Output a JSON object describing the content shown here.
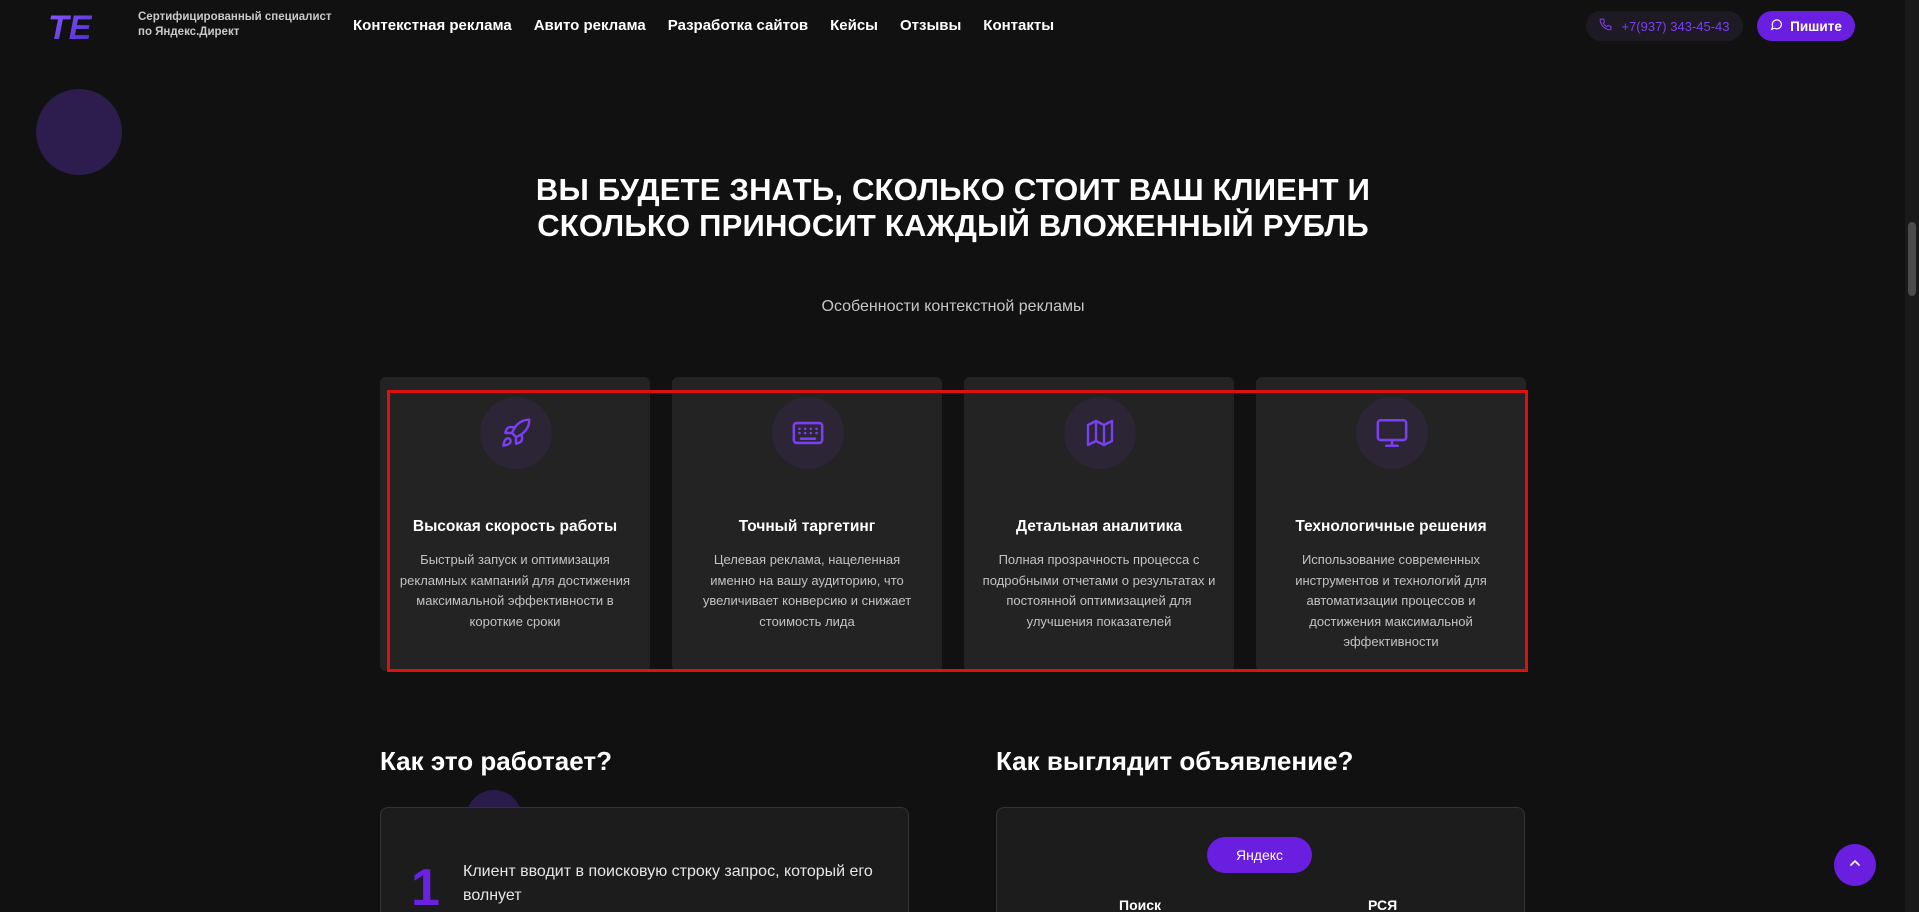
{
  "header": {
    "logo_text": "TE",
    "tagline": "Сертифицированный специалист по Яндекс.Директ",
    "nav": [
      "Контекстная реклама",
      "Авито реклама",
      "Разработка сайтов",
      "Кейсы",
      "Отзывы",
      "Контакты"
    ],
    "phone": "+7(937) 343-45-43",
    "phone_icon": "phone-icon",
    "write_button": "Пишите",
    "write_icon": "chat-bubble-icon"
  },
  "hero": {
    "title": "ВЫ БУДЕТЕ ЗНАТЬ, СКОЛЬКО СТОИТ ВАШ КЛИЕНТ И СКОЛЬКО ПРИНОСИТ КАЖДЫЙ ВЛОЖЕННЫЙ РУБЛЬ",
    "subtitle": "Особенности контекстной рекламы"
  },
  "features": [
    {
      "icon": "rocket-icon",
      "title": "Высокая скорость работы",
      "text": "Быстрый запуск и оптимизация рекламных кампаний для достижения максимальной эффективности в короткие сроки"
    },
    {
      "icon": "keyboard-icon",
      "title": "Точный таргетинг",
      "text": "Целевая реклама, нацеленная именно на вашу аудиторию, что увеличивает конверсию и снижает стоимость лида"
    },
    {
      "icon": "map-icon",
      "title": "Детальная аналитика",
      "text": "Полная прозрачность процесса с подробными отчетами о результатах и постоянной оптимизацией для улучшения показателей"
    },
    {
      "icon": "monitor-icon",
      "title": "Технологичные решения",
      "text": "Использование современных инструментов и технологий для автоматизации процессов и достижения максимальной эффективности"
    }
  ],
  "how_it_works": {
    "heading": "Как это работает?",
    "step_number": "1",
    "step_text": "Клиент вводит в поисковую строку запрос, который его волнует"
  },
  "ad_preview": {
    "heading": "Как выглядит объявление?",
    "pill": "Яндекс",
    "tabs": [
      "Поиск",
      "РСЯ"
    ]
  },
  "colors": {
    "accent": "#6a1ee0",
    "background": "#111111",
    "card": "#232323",
    "highlight": "#dd1111"
  }
}
